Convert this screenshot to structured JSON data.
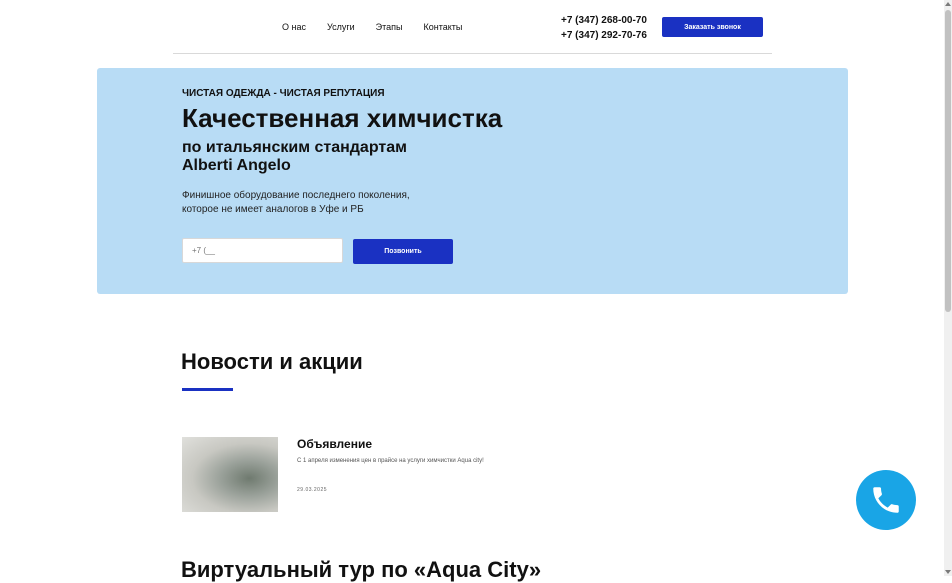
{
  "nav": {
    "items": [
      {
        "label": "О нас"
      },
      {
        "label": "Услуги"
      },
      {
        "label": "Этапы"
      },
      {
        "label": "Контакты"
      }
    ]
  },
  "contacts": {
    "phone1": "+7 (347) 268-00-70",
    "phone2": "+7 (347) 292-70-76",
    "callback_label": "Заказать звонок"
  },
  "hero": {
    "eyebrow": "ЧИСТАЯ ОДЕЖДА - ЧИСТАЯ РЕПУТАЦИЯ",
    "title": "Качественная химчистка",
    "subtitle_line1": "по итальянским стандартам",
    "subtitle_line2": "Alberti Angelo",
    "desc_line1": "Финишное оборудование последнего поколения,",
    "desc_line2": "которое не имеет аналогов в Уфе и РБ",
    "phone_placeholder": "+7 (__",
    "call_label": "Позвонить"
  },
  "news": {
    "title": "Новости и акции",
    "items": [
      {
        "title": "Объявление",
        "text": "С 1 апреля изменения цен в прайсе на услуги химчистки Aqua city!",
        "date": "29.03.2025"
      }
    ]
  },
  "tour": {
    "title": "Виртуальный тур по «Aqua City»"
  },
  "colors": {
    "accent": "#1a31c2",
    "hero_bg": "#b8dcf5",
    "fab": "#19a5e6"
  },
  "icons": {
    "fab": "phone-icon"
  }
}
